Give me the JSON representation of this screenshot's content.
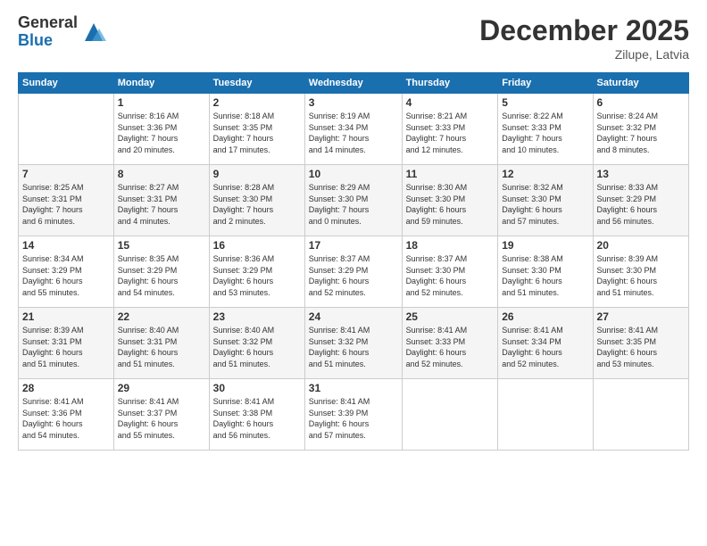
{
  "logo": {
    "general": "General",
    "blue": "Blue"
  },
  "title": "December 2025",
  "subtitle": "Zilupe, Latvia",
  "days_header": [
    "Sunday",
    "Monday",
    "Tuesday",
    "Wednesday",
    "Thursday",
    "Friday",
    "Saturday"
  ],
  "weeks": [
    [
      {
        "day": "",
        "info": ""
      },
      {
        "day": "1",
        "info": "Sunrise: 8:16 AM\nSunset: 3:36 PM\nDaylight: 7 hours\nand 20 minutes."
      },
      {
        "day": "2",
        "info": "Sunrise: 8:18 AM\nSunset: 3:35 PM\nDaylight: 7 hours\nand 17 minutes."
      },
      {
        "day": "3",
        "info": "Sunrise: 8:19 AM\nSunset: 3:34 PM\nDaylight: 7 hours\nand 14 minutes."
      },
      {
        "day": "4",
        "info": "Sunrise: 8:21 AM\nSunset: 3:33 PM\nDaylight: 7 hours\nand 12 minutes."
      },
      {
        "day": "5",
        "info": "Sunrise: 8:22 AM\nSunset: 3:33 PM\nDaylight: 7 hours\nand 10 minutes."
      },
      {
        "day": "6",
        "info": "Sunrise: 8:24 AM\nSunset: 3:32 PM\nDaylight: 7 hours\nand 8 minutes."
      }
    ],
    [
      {
        "day": "7",
        "info": "Sunrise: 8:25 AM\nSunset: 3:31 PM\nDaylight: 7 hours\nand 6 minutes."
      },
      {
        "day": "8",
        "info": "Sunrise: 8:27 AM\nSunset: 3:31 PM\nDaylight: 7 hours\nand 4 minutes."
      },
      {
        "day": "9",
        "info": "Sunrise: 8:28 AM\nSunset: 3:30 PM\nDaylight: 7 hours\nand 2 minutes."
      },
      {
        "day": "10",
        "info": "Sunrise: 8:29 AM\nSunset: 3:30 PM\nDaylight: 7 hours\nand 0 minutes."
      },
      {
        "day": "11",
        "info": "Sunrise: 8:30 AM\nSunset: 3:30 PM\nDaylight: 6 hours\nand 59 minutes."
      },
      {
        "day": "12",
        "info": "Sunrise: 8:32 AM\nSunset: 3:30 PM\nDaylight: 6 hours\nand 57 minutes."
      },
      {
        "day": "13",
        "info": "Sunrise: 8:33 AM\nSunset: 3:29 PM\nDaylight: 6 hours\nand 56 minutes."
      }
    ],
    [
      {
        "day": "14",
        "info": "Sunrise: 8:34 AM\nSunset: 3:29 PM\nDaylight: 6 hours\nand 55 minutes."
      },
      {
        "day": "15",
        "info": "Sunrise: 8:35 AM\nSunset: 3:29 PM\nDaylight: 6 hours\nand 54 minutes."
      },
      {
        "day": "16",
        "info": "Sunrise: 8:36 AM\nSunset: 3:29 PM\nDaylight: 6 hours\nand 53 minutes."
      },
      {
        "day": "17",
        "info": "Sunrise: 8:37 AM\nSunset: 3:29 PM\nDaylight: 6 hours\nand 52 minutes."
      },
      {
        "day": "18",
        "info": "Sunrise: 8:37 AM\nSunset: 3:30 PM\nDaylight: 6 hours\nand 52 minutes."
      },
      {
        "day": "19",
        "info": "Sunrise: 8:38 AM\nSunset: 3:30 PM\nDaylight: 6 hours\nand 51 minutes."
      },
      {
        "day": "20",
        "info": "Sunrise: 8:39 AM\nSunset: 3:30 PM\nDaylight: 6 hours\nand 51 minutes."
      }
    ],
    [
      {
        "day": "21",
        "info": "Sunrise: 8:39 AM\nSunset: 3:31 PM\nDaylight: 6 hours\nand 51 minutes."
      },
      {
        "day": "22",
        "info": "Sunrise: 8:40 AM\nSunset: 3:31 PM\nDaylight: 6 hours\nand 51 minutes."
      },
      {
        "day": "23",
        "info": "Sunrise: 8:40 AM\nSunset: 3:32 PM\nDaylight: 6 hours\nand 51 minutes."
      },
      {
        "day": "24",
        "info": "Sunrise: 8:41 AM\nSunset: 3:32 PM\nDaylight: 6 hours\nand 51 minutes."
      },
      {
        "day": "25",
        "info": "Sunrise: 8:41 AM\nSunset: 3:33 PM\nDaylight: 6 hours\nand 52 minutes."
      },
      {
        "day": "26",
        "info": "Sunrise: 8:41 AM\nSunset: 3:34 PM\nDaylight: 6 hours\nand 52 minutes."
      },
      {
        "day": "27",
        "info": "Sunrise: 8:41 AM\nSunset: 3:35 PM\nDaylight: 6 hours\nand 53 minutes."
      }
    ],
    [
      {
        "day": "28",
        "info": "Sunrise: 8:41 AM\nSunset: 3:36 PM\nDaylight: 6 hours\nand 54 minutes."
      },
      {
        "day": "29",
        "info": "Sunrise: 8:41 AM\nSunset: 3:37 PM\nDaylight: 6 hours\nand 55 minutes."
      },
      {
        "day": "30",
        "info": "Sunrise: 8:41 AM\nSunset: 3:38 PM\nDaylight: 6 hours\nand 56 minutes."
      },
      {
        "day": "31",
        "info": "Sunrise: 8:41 AM\nSunset: 3:39 PM\nDaylight: 6 hours\nand 57 minutes."
      },
      {
        "day": "",
        "info": ""
      },
      {
        "day": "",
        "info": ""
      },
      {
        "day": "",
        "info": ""
      }
    ]
  ]
}
